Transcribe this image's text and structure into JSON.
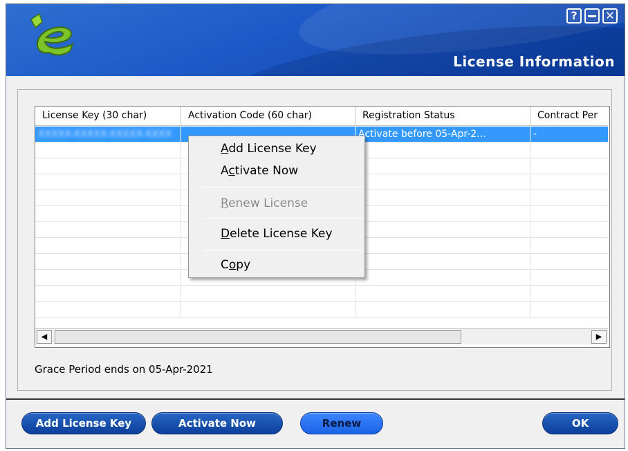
{
  "window": {
    "title": "License Information",
    "help_glyph": "?",
    "close_glyph": "✕",
    "brand_colors": {
      "header_blue": "#1e5bc8",
      "logo_green": "#7cc229"
    }
  },
  "table": {
    "columns": [
      "License Key (30 char)",
      "Activation Code (60 char)",
      "Registration Status",
      "Contract Per"
    ],
    "selected_row": {
      "license_key": "XXXXX-XXXXX-XXXXX-XXXX",
      "activation_code": "",
      "registration_status": "Activate before  05-Apr-2...",
      "contract_period": "-"
    }
  },
  "scroll": {
    "left_glyph": "◀",
    "right_glyph": "▶"
  },
  "context_menu": {
    "add_key": {
      "pre": "",
      "key": "A",
      "post": "dd License Key"
    },
    "activate": {
      "pre": "A",
      "key": "c",
      "post": "tivate Now"
    },
    "renew": {
      "pre": "",
      "key": "R",
      "post": "enew License"
    },
    "delete": {
      "pre": "",
      "key": "D",
      "post": "elete License Key"
    },
    "copy": {
      "pre": "C",
      "key": "o",
      "post": "py"
    }
  },
  "grace_text": "Grace Period ends on 05-Apr-2021",
  "buttons": {
    "add_license_key": "Add License Key",
    "activate_now": "Activate Now",
    "renew": "Renew",
    "ok": "OK"
  }
}
